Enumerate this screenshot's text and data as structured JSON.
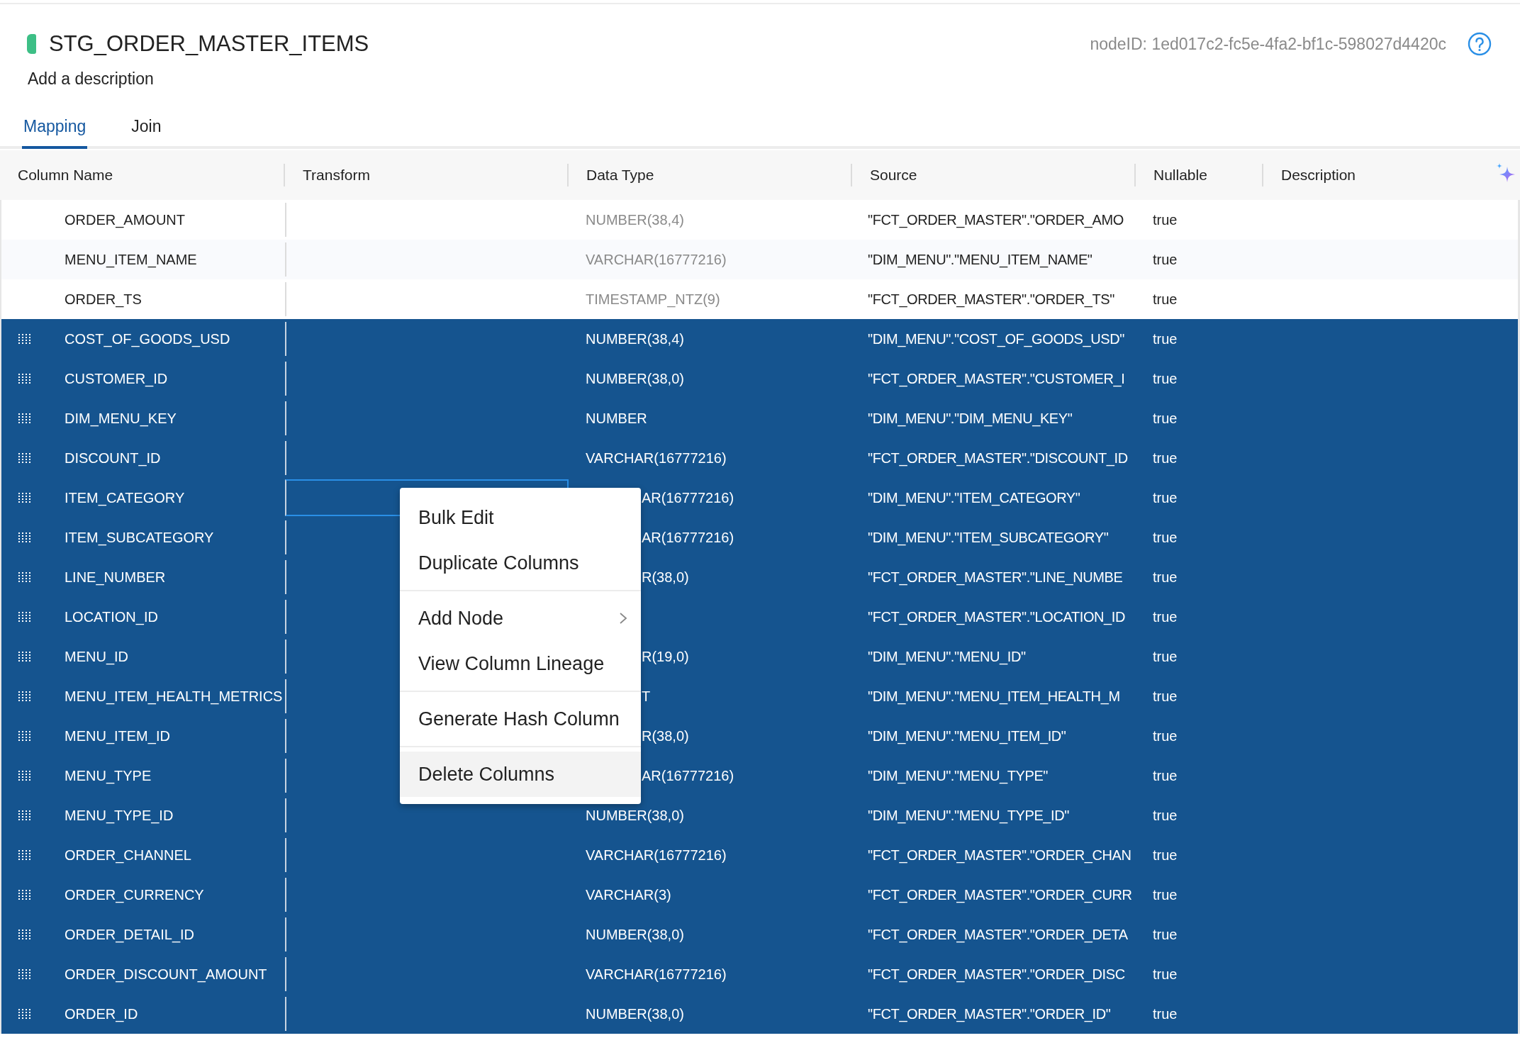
{
  "node": {
    "title": "STG_ORDER_MASTER_ITEMS",
    "description_placeholder": "Add a description",
    "node_id": "nodeID: 1ed017c2-fc5e-4fa2-bf1c-598027d4420c"
  },
  "tabs": [
    {
      "label": "Mapping",
      "selected": true
    },
    {
      "label": "Join",
      "selected": false
    }
  ],
  "table": {
    "columns": [
      "Column Name",
      "Transform",
      "Data Type",
      "Source",
      "Nullable",
      "Description"
    ],
    "rows": [
      {
        "column_name": "ORDER_AMOUNT",
        "data_type": "NUMBER(38,4)",
        "source": "\"FCT_ORDER_MASTER\".\"ORDER_AMO",
        "nullable": "true",
        "selected": false,
        "focused": false
      },
      {
        "column_name": "MENU_ITEM_NAME",
        "data_type": "VARCHAR(16777216)",
        "source": "\"DIM_MENU\".\"MENU_ITEM_NAME\"",
        "nullable": "true",
        "selected": false,
        "focused": false
      },
      {
        "column_name": "ORDER_TS",
        "data_type": "TIMESTAMP_NTZ(9)",
        "source": "\"FCT_ORDER_MASTER\".\"ORDER_TS\"",
        "nullable": "true",
        "selected": false,
        "focused": false
      },
      {
        "column_name": "COST_OF_GOODS_USD",
        "data_type": "NUMBER(38,4)",
        "source": "\"DIM_MENU\".\"COST_OF_GOODS_USD\"",
        "nullable": "true",
        "selected": true,
        "focused": false
      },
      {
        "column_name": "CUSTOMER_ID",
        "data_type": "NUMBER(38,0)",
        "source": "\"FCT_ORDER_MASTER\".\"CUSTOMER_I",
        "nullable": "true",
        "selected": true,
        "focused": false
      },
      {
        "column_name": "DIM_MENU_KEY",
        "data_type": "NUMBER",
        "source": "\"DIM_MENU\".\"DIM_MENU_KEY\"",
        "nullable": "true",
        "selected": true,
        "focused": false
      },
      {
        "column_name": "DISCOUNT_ID",
        "data_type": "VARCHAR(16777216)",
        "source": "\"FCT_ORDER_MASTER\".\"DISCOUNT_ID",
        "nullable": "true",
        "selected": true,
        "focused": false
      },
      {
        "column_name": "ITEM_CATEGORY",
        "data_type": "AR(16777216)",
        "source": "\"DIM_MENU\".\"ITEM_CATEGORY\"",
        "nullable": "true",
        "selected": true,
        "focused": true
      },
      {
        "column_name": "ITEM_SUBCATEGORY",
        "data_type": "AR(16777216)",
        "source": "\"DIM_MENU\".\"ITEM_SUBCATEGORY\"",
        "nullable": "true",
        "selected": true,
        "focused": false
      },
      {
        "column_name": "LINE_NUMBER",
        "data_type": "R(38,0)",
        "source": "\"FCT_ORDER_MASTER\".\"LINE_NUMBE",
        "nullable": "true",
        "selected": true,
        "focused": false
      },
      {
        "column_name": "LOCATION_ID",
        "source": "\"FCT_ORDER_MASTER\".\"LOCATION_ID",
        "nullable": "true",
        "selected": true,
        "focused": false
      },
      {
        "column_name": "MENU_ID",
        "data_type": "R(19,0)",
        "source": "\"DIM_MENU\".\"MENU_ID\"",
        "nullable": "true",
        "selected": true,
        "focused": false
      },
      {
        "column_name": "MENU_ITEM_HEALTH_METRICS",
        "data_type": "T",
        "source": "\"DIM_MENU\".\"MENU_ITEM_HEALTH_M",
        "nullable": "true",
        "selected": true,
        "focused": false
      },
      {
        "column_name": "MENU_ITEM_ID",
        "data_type": "R(38,0)",
        "source": "\"DIM_MENU\".\"MENU_ITEM_ID\"",
        "nullable": "true",
        "selected": true,
        "focused": false
      },
      {
        "column_name": "MENU_TYPE",
        "data_type": "AR(16777216)",
        "source": "\"DIM_MENU\".\"MENU_TYPE\"",
        "nullable": "true",
        "selected": true,
        "focused": false
      },
      {
        "column_name": "MENU_TYPE_ID",
        "data_type": "NUMBER(38,0)",
        "source": "\"DIM_MENU\".\"MENU_TYPE_ID\"",
        "nullable": "true",
        "selected": true,
        "focused": false
      },
      {
        "column_name": "ORDER_CHANNEL",
        "data_type": "VARCHAR(16777216)",
        "source": "\"FCT_ORDER_MASTER\".\"ORDER_CHAN",
        "nullable": "true",
        "selected": true,
        "focused": false
      },
      {
        "column_name": "ORDER_CURRENCY",
        "data_type": "VARCHAR(3)",
        "source": "\"FCT_ORDER_MASTER\".\"ORDER_CURR",
        "nullable": "true",
        "selected": true,
        "focused": false
      },
      {
        "column_name": "ORDER_DETAIL_ID",
        "data_type": "NUMBER(38,0)",
        "source": "\"FCT_ORDER_MASTER\".\"ORDER_DETA",
        "nullable": "true",
        "selected": true,
        "focused": false
      },
      {
        "column_name": "ORDER_DISCOUNT_AMOUNT",
        "data_type": "VARCHAR(16777216)",
        "source": "\"FCT_ORDER_MASTER\".\"ORDER_DISC",
        "nullable": "true",
        "selected": true,
        "focused": false
      },
      {
        "column_name": "ORDER_ID",
        "data_type": "NUMBER(38,0)",
        "source": "\"FCT_ORDER_MASTER\".\"ORDER_ID\"",
        "nullable": "true",
        "selected": true,
        "focused": false
      }
    ]
  },
  "context_menu": {
    "groups": [
      [
        {
          "label": "Bulk Edit",
          "submenu": false,
          "selected": false
        },
        {
          "label": "Duplicate Columns",
          "submenu": false,
          "selected": false
        }
      ],
      [
        {
          "label": "Add Node",
          "submenu": true,
          "selected": false
        },
        {
          "label": "View Column Lineage",
          "submenu": false,
          "selected": false
        }
      ],
      [
        {
          "label": "Generate Hash Column",
          "submenu": false,
          "selected": false
        }
      ],
      [
        {
          "label": "Delete Columns",
          "submenu": false,
          "selected": true
        }
      ]
    ]
  }
}
